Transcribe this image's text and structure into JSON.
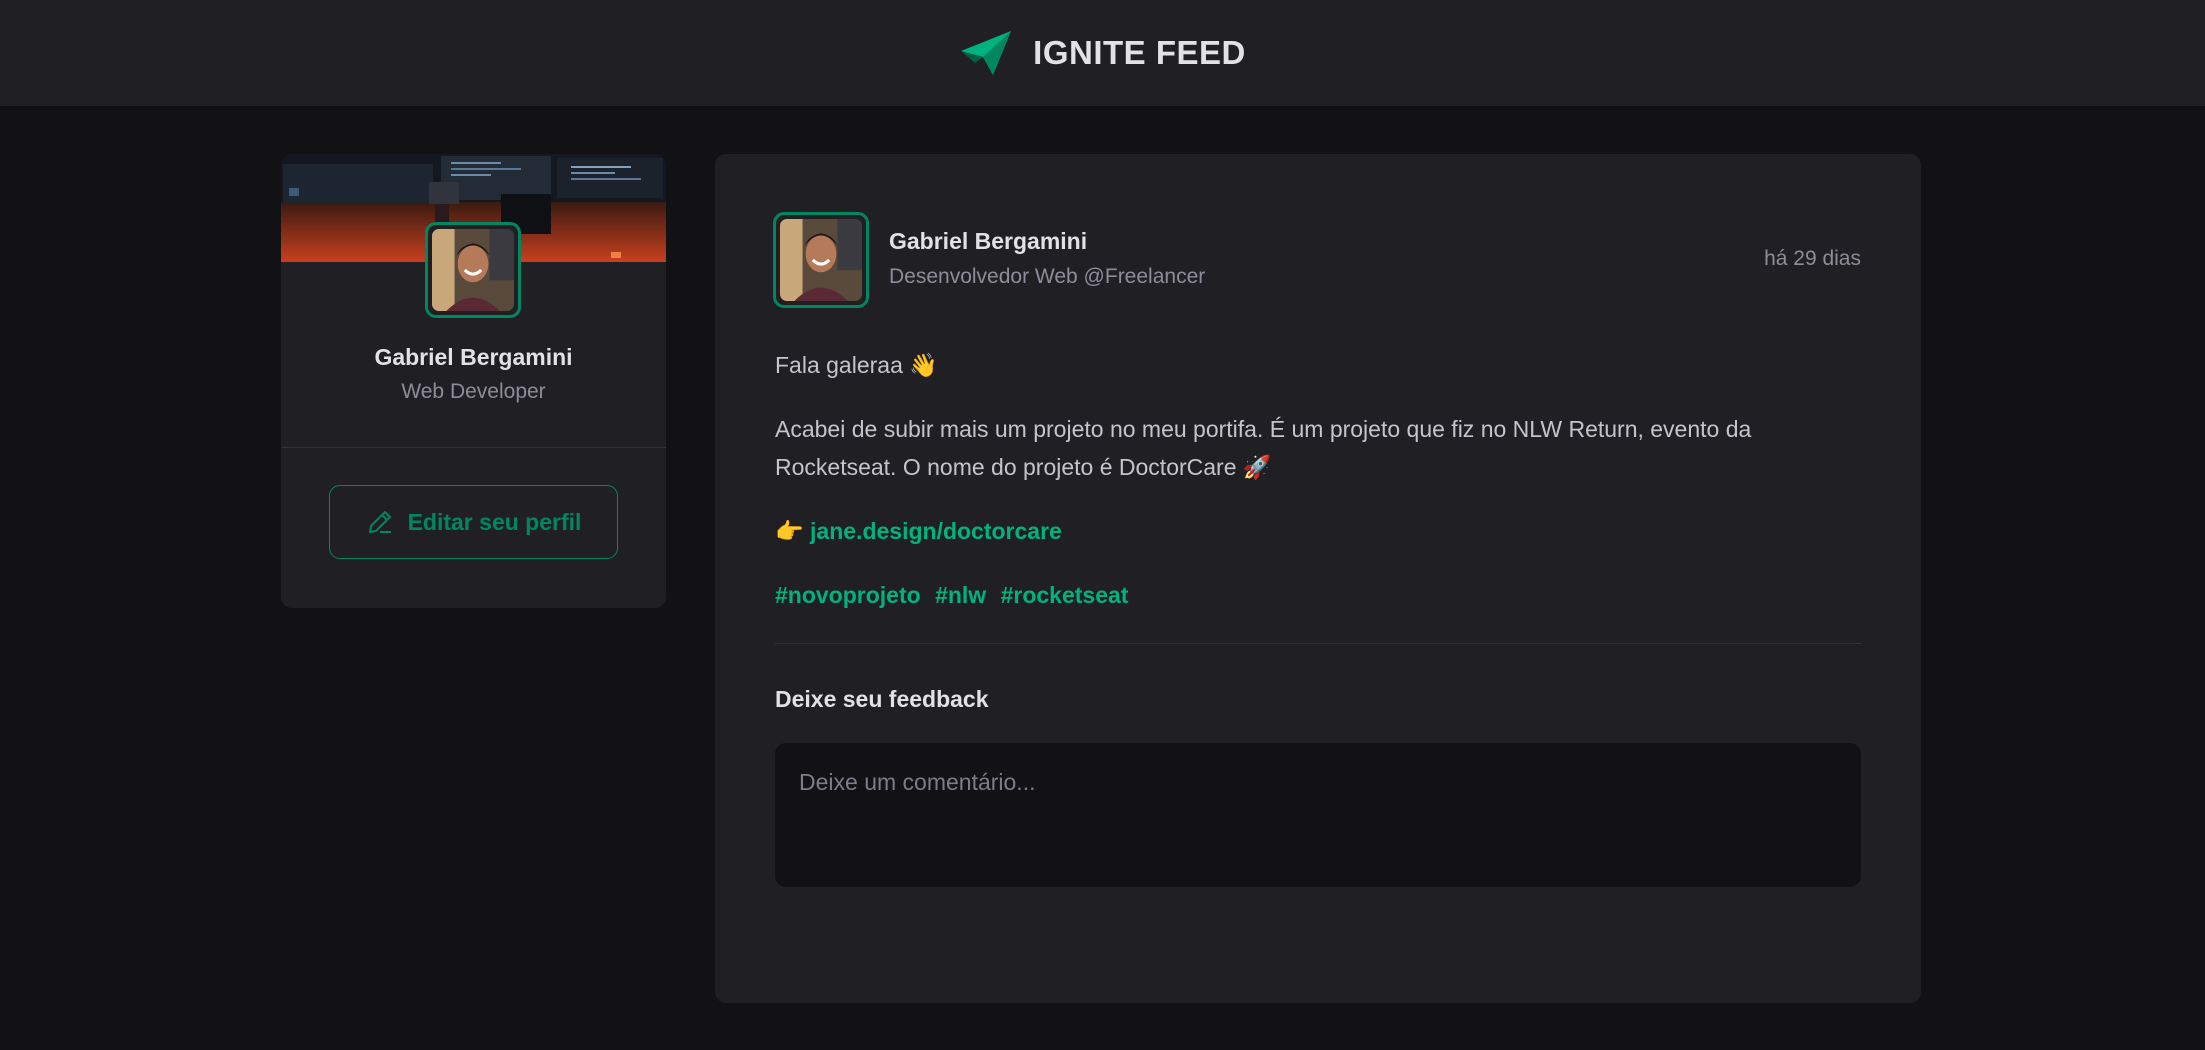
{
  "header": {
    "logo_icon": "ignite-logo-icon",
    "title": "IGNITE FEED"
  },
  "sidebar": {
    "cover_image": "desk-setup-cover-image",
    "avatar": "profile-avatar",
    "name": "Gabriel Bergamini",
    "role": "Web Developer",
    "edit_icon": "pencil-icon",
    "edit_label": "Editar seu perfil"
  },
  "post": {
    "author": {
      "name": "Gabriel Bergamini",
      "role": "Desenvolvedor Web @Freelancer"
    },
    "time": "há 29 dias",
    "greeting": "Fala galeraa",
    "greeting_emoji": "👋",
    "body_text": "Acabei de subir mais um projeto no meu portifa. É um projeto que fiz no NLW Return, evento da Rocketseat. O nome do projeto é DoctorCare",
    "body_emoji": "🚀",
    "link_emoji": "👉",
    "link": "jane.design/doctorcare",
    "tags": [
      "#novoprojeto",
      "#nlw",
      "#rocketseat"
    ]
  },
  "feedback": {
    "title": "Deixe seu feedback",
    "placeholder": "Deixe um comentário..."
  },
  "colors": {
    "background": "#121214",
    "surface": "#202024",
    "accent": "#00875f",
    "accent_light": "#00b37e",
    "text_primary": "#e1e1e6",
    "text_secondary": "#8d8d99"
  }
}
